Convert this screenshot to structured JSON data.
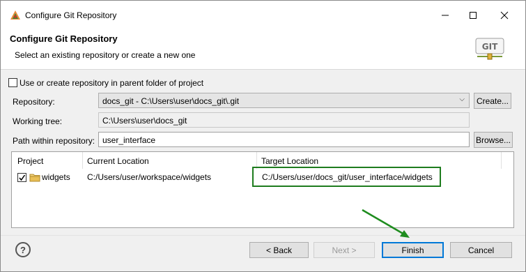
{
  "window": {
    "title": "Configure Git Repository"
  },
  "banner": {
    "title": "Configure Git Repository",
    "description": "Select an existing repository or create a new one",
    "logo_text": "GIT"
  },
  "parent_folder_checkbox": {
    "label": "Use or create repository in parent folder of project",
    "checked": false
  },
  "repository": {
    "label": "Repository:",
    "value": "docs_git - C:\\Users\\user\\docs_git\\.git",
    "create_button": "Create..."
  },
  "working_tree": {
    "label": "Working tree:",
    "value": "C:\\Users\\user\\docs_git"
  },
  "path_within": {
    "label": "Path within repository:",
    "value": "user_interface",
    "browse_button": "Browse..."
  },
  "table": {
    "headers": [
      "Project",
      "Current Location",
      "Target Location"
    ],
    "rows": [
      {
        "checked": true,
        "project": "widgets",
        "current": "C:/Users/user/workspace/widgets",
        "target": "C:/Users/user/docs_git/user_interface/widgets"
      }
    ]
  },
  "footer": {
    "help": "?",
    "back": "< Back",
    "next": "Next >",
    "finish": "Finish",
    "cancel": "Cancel"
  },
  "colors": {
    "highlight": "#1e7c1e",
    "accent": "#0078d7"
  },
  "icons": [
    "eclipse-app-icon",
    "minimize-icon",
    "maximize-icon",
    "close-icon",
    "git-logo-icon",
    "folder-icon",
    "help-icon",
    "green-arrow-icon"
  ]
}
